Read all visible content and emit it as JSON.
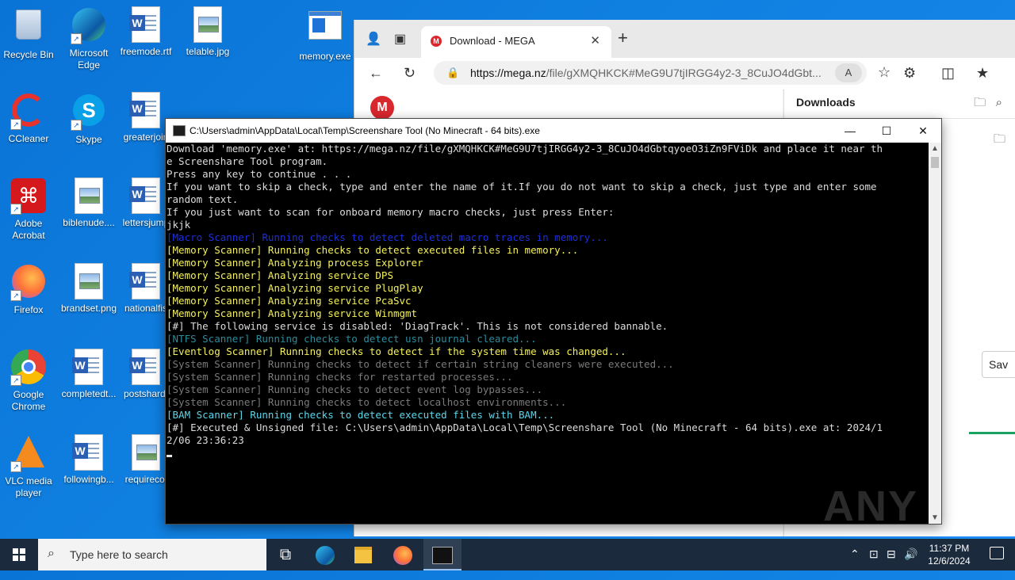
{
  "desktop": {
    "icons": [
      {
        "label": "Recycle Bin",
        "kind": "recycle"
      },
      {
        "label": "Microsoft Edge",
        "kind": "edge"
      },
      {
        "label": "freemode.rtf",
        "kind": "word"
      },
      {
        "label": "telable.jpg",
        "kind": "image"
      },
      {
        "label": "memory.exe",
        "kind": "exe"
      },
      {
        "label": "CCleaner",
        "kind": "ccleaner"
      },
      {
        "label": "Skype",
        "kind": "skype"
      },
      {
        "label": "greaterjoin",
        "kind": "word"
      },
      {
        "label": "Adobe Acrobat",
        "kind": "acrobat"
      },
      {
        "label": "biblenude....",
        "kind": "image"
      },
      {
        "label": "lettersjump",
        "kind": "word"
      },
      {
        "label": "Firefox",
        "kind": "firefox"
      },
      {
        "label": "brandset.png",
        "kind": "image"
      },
      {
        "label": "nationalfis",
        "kind": "word"
      },
      {
        "label": "Google Chrome",
        "kind": "chrome"
      },
      {
        "label": "completedt...",
        "kind": "word"
      },
      {
        "label": "postshard.",
        "kind": "word"
      },
      {
        "label": "VLC media player",
        "kind": "vlc"
      },
      {
        "label": "followingb...",
        "kind": "word"
      },
      {
        "label": "requirecol",
        "kind": "image"
      }
    ]
  },
  "browser": {
    "tab_title": "Download - MEGA",
    "url_host": "https://mega.nz",
    "url_rest": "/file/gXMQHKCK#MeG9U7tjIRGG4y2-3_8CuJO4dGbt...",
    "downloads_title": "Downloads",
    "save_label": "Sav"
  },
  "console": {
    "title": "C:\\Users\\admin\\AppData\\Local\\Temp\\Screenshare Tool (No Minecraft - 64 bits).exe",
    "lines": [
      {
        "text": "Download 'memory.exe' at: https://mega.nz/file/gXMQHKCK#MeG9U7tjIRGG4y2-3_8CuJO4dGbtqyoeO3iZn9FViDk and place it near th",
        "color": "white"
      },
      {
        "text": "e Screenshare Tool program.",
        "color": "white"
      },
      {
        "text": "Press any key to continue . . .",
        "color": "white"
      },
      {
        "text": "If you want to skip a check, type and enter the name of it.If you do not want to skip a check, just type and enter some",
        "color": "white"
      },
      {
        "text": "random text.",
        "color": "white"
      },
      {
        "text": "If you just want to scan for onboard memory macro checks, just press Enter:",
        "color": "white"
      },
      {
        "text": "jkjk",
        "color": "white"
      },
      {
        "text": "[Macro Scanner] Running checks to detect deleted macro traces in memory...",
        "color": "blue"
      },
      {
        "text": "[Memory Scanner] Running checks to detect executed files in memory...",
        "color": "yellow"
      },
      {
        "text": "[Memory Scanner] Analyzing process Explorer",
        "color": "yellow"
      },
      {
        "text": "[Memory Scanner] Analyzing service DPS",
        "color": "yellow"
      },
      {
        "text": "[Memory Scanner] Analyzing service PlugPlay",
        "color": "yellow"
      },
      {
        "text": "[Memory Scanner] Analyzing service PcaSvc",
        "color": "yellow"
      },
      {
        "text": "[Memory Scanner] Analyzing service Winmgmt",
        "color": "yellow"
      },
      {
        "text": "[#] The following service is disabled: 'DiagTrack'. This is not considered bannable.",
        "color": "white"
      },
      {
        "text": "[NTFS Scanner] Running checks to detect usn journal cleared...",
        "color": "teal"
      },
      {
        "text": "[Eventlog Scanner] Running checks to detect if the system time was changed...",
        "color": "yellow"
      },
      {
        "text": "[System Scanner] Running checks to detect if certain string cleaners were executed...",
        "color": "gray"
      },
      {
        "text": "[System Scanner] Running checks for restarted processes...",
        "color": "gray"
      },
      {
        "text": "[System Scanner] Running checks to detect event log bypasses...",
        "color": "gray"
      },
      {
        "text": "[System Scanner] Running checks to detect localhost environments...",
        "color": "gray"
      },
      {
        "text": "[BAM Scanner] Running checks to detect executed files with BAM...",
        "color": "cyan"
      },
      {
        "text": "[#] Executed & Unsigned file: C:\\Users\\admin\\AppData\\Local\\Temp\\Screenshare Tool (No Minecraft - 64 bits).exe at: 2024/1",
        "color": "white"
      },
      {
        "text": "2/06 23:36:23",
        "color": "white"
      }
    ]
  },
  "watermark": "ANY RUN",
  "taskbar": {
    "search_placeholder": "Type here to search",
    "time": "11:37 PM",
    "date": "12/6/2024"
  }
}
